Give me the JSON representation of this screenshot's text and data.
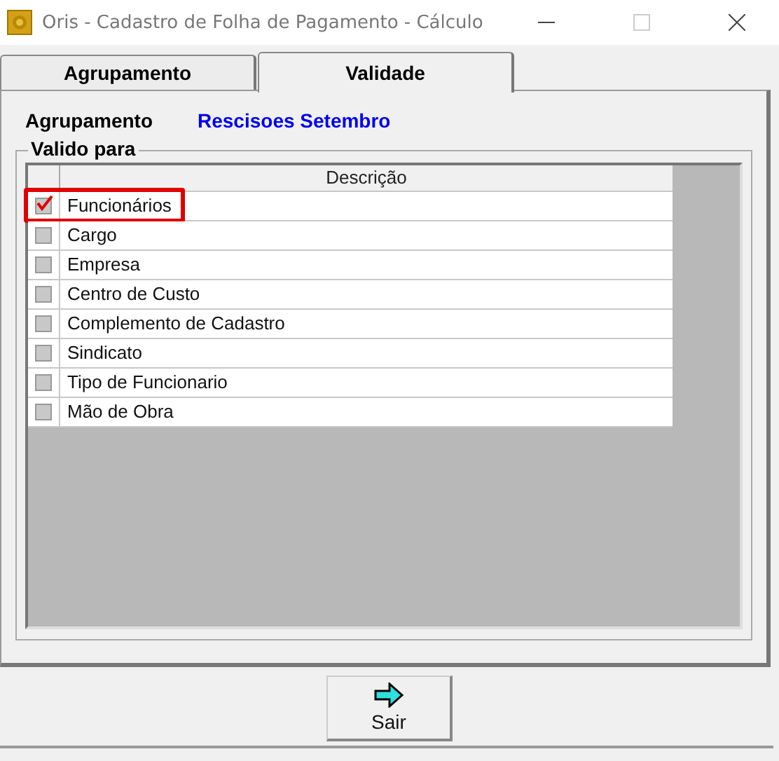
{
  "window": {
    "title": "Oris - Cadastro de Folha de Pagamento - Cálculo"
  },
  "tabs": [
    {
      "label": "Agrupamento",
      "selected": false
    },
    {
      "label": "Validade",
      "selected": true
    }
  ],
  "agrupamento": {
    "label": "Agrupamento",
    "value": "Rescisoes Setembro"
  },
  "group": {
    "title": "Valido para"
  },
  "table": {
    "columns": [
      "Descrição"
    ],
    "rows": [
      {
        "text": "Funcionários",
        "checked": true,
        "highlighted": true
      },
      {
        "text": "Cargo",
        "checked": false,
        "highlighted": false
      },
      {
        "text": "Empresa",
        "checked": false,
        "highlighted": false
      },
      {
        "text": "Centro de Custo",
        "checked": false,
        "highlighted": false
      },
      {
        "text": "Complemento de Cadastro",
        "checked": false,
        "highlighted": false
      },
      {
        "text": "Sindicato",
        "checked": false,
        "highlighted": false
      },
      {
        "text": "Tipo de Funcionario",
        "checked": false,
        "highlighted": false
      },
      {
        "text": "Mão de Obra",
        "checked": false,
        "highlighted": false
      }
    ]
  },
  "buttons": [
    {
      "label": "Sair"
    }
  ]
}
